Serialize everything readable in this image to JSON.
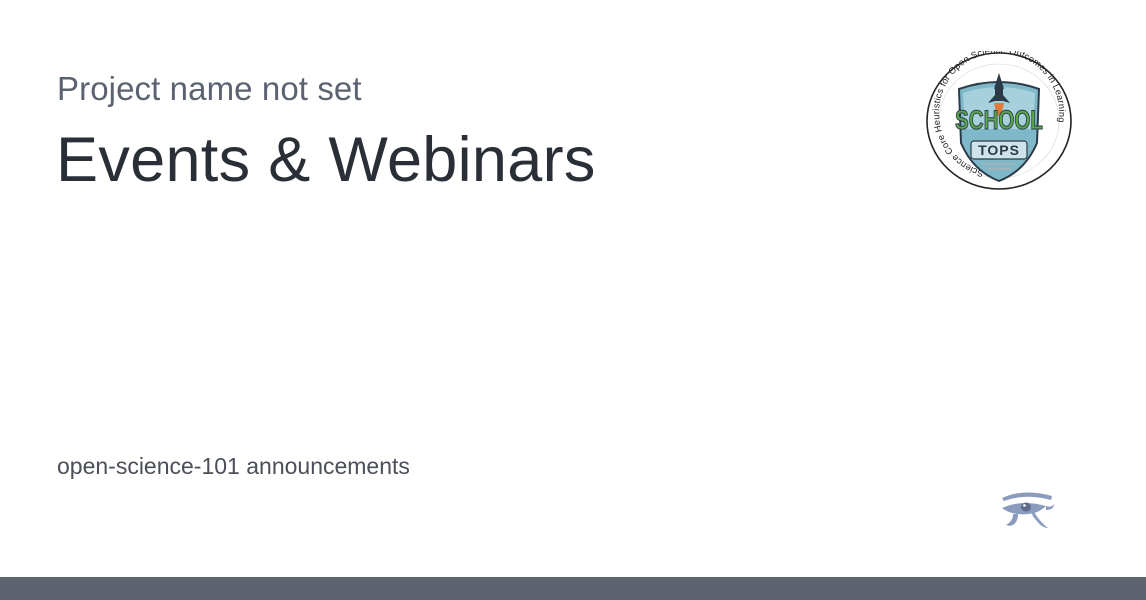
{
  "project": {
    "name": "Project name not set"
  },
  "page": {
    "title": "Events & Webinars",
    "subtitle": "open-science-101 announcements"
  },
  "logo": {
    "icon": "school-tops-badge",
    "ring_text": "Science Core Heuristics for Open Science Outcomes in Learning",
    "word_top": "SCHOOL",
    "word_bottom": "TOPS"
  },
  "brand": {
    "icon": "eye-of-horus-icon"
  },
  "colors": {
    "title": "#2a2f37",
    "muted": "#5c6370",
    "footer": "#5d6470",
    "badge_green": "#5aa84a",
    "badge_blue": "#7fb8c8"
  }
}
